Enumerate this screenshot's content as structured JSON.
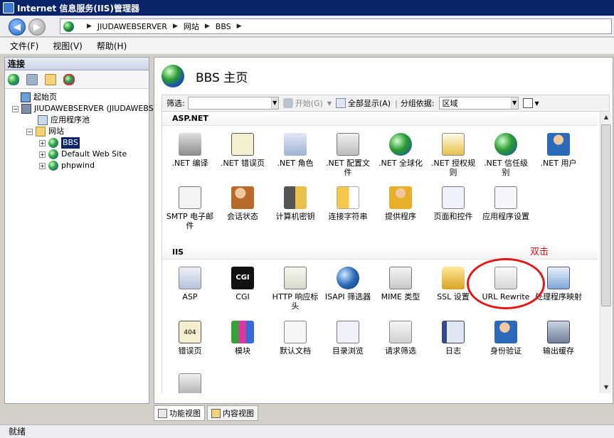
{
  "window": {
    "title": "Internet 信息服务(IIS)管理器"
  },
  "address": {
    "crumbs": [
      "JIUDAWEBSERVER",
      "网站",
      "BBS"
    ]
  },
  "menu": [
    "文件(F)",
    "视图(V)",
    "帮助(H)"
  ],
  "left": {
    "header": "连接",
    "tree": {
      "start": "起始页",
      "server": "JIUDAWEBSERVER (JIUDAWEBSE",
      "apppool": "应用程序池",
      "sites": "网站",
      "site_items": [
        "BBS",
        "Default Web Site",
        "phpwind"
      ]
    }
  },
  "right": {
    "title": "BBS 主页",
    "filter": {
      "label": "筛选:",
      "start": "开始(G)",
      "showall": "全部显示(A)",
      "groupby": "分组依据:",
      "groupval": "区域"
    },
    "groups": {
      "aspnet": "ASP.NET",
      "iis": "IIS"
    },
    "aspnet_row1": [
      ".NET 编译",
      ".NET 错误页",
      ".NET 角色",
      ".NET 配置文件",
      ".NET 全球化",
      ".NET 授权规则",
      ".NET 信任级别",
      ".NET 用户"
    ],
    "aspnet_row2": [
      "SMTP 电子邮件",
      "会话状态",
      "计算机密钥",
      "连接字符串",
      "提供程序",
      "页面和控件",
      "应用程序设置"
    ],
    "iis_row1": [
      "ASP",
      "CGI",
      "HTTP 响应标头",
      "ISAPI 筛选器",
      "MIME 类型",
      "SSL 设置",
      "URL Rewrite",
      "处理程序映射"
    ],
    "iis_row2": [
      "错误页",
      "模块",
      "默认文档",
      "目录浏览",
      "请求筛选",
      "日志",
      "身份验证",
      "输出缓存"
    ],
    "cgi_icon_text": "CGI",
    "error_icon_text": "404"
  },
  "annotation": "双击",
  "tabs": [
    "功能视图",
    "内容视图"
  ],
  "status": "就绪",
  "colors": {
    "annotation": "#e01818",
    "titlebar": "#0a246a",
    "selection": "#0a246a"
  }
}
